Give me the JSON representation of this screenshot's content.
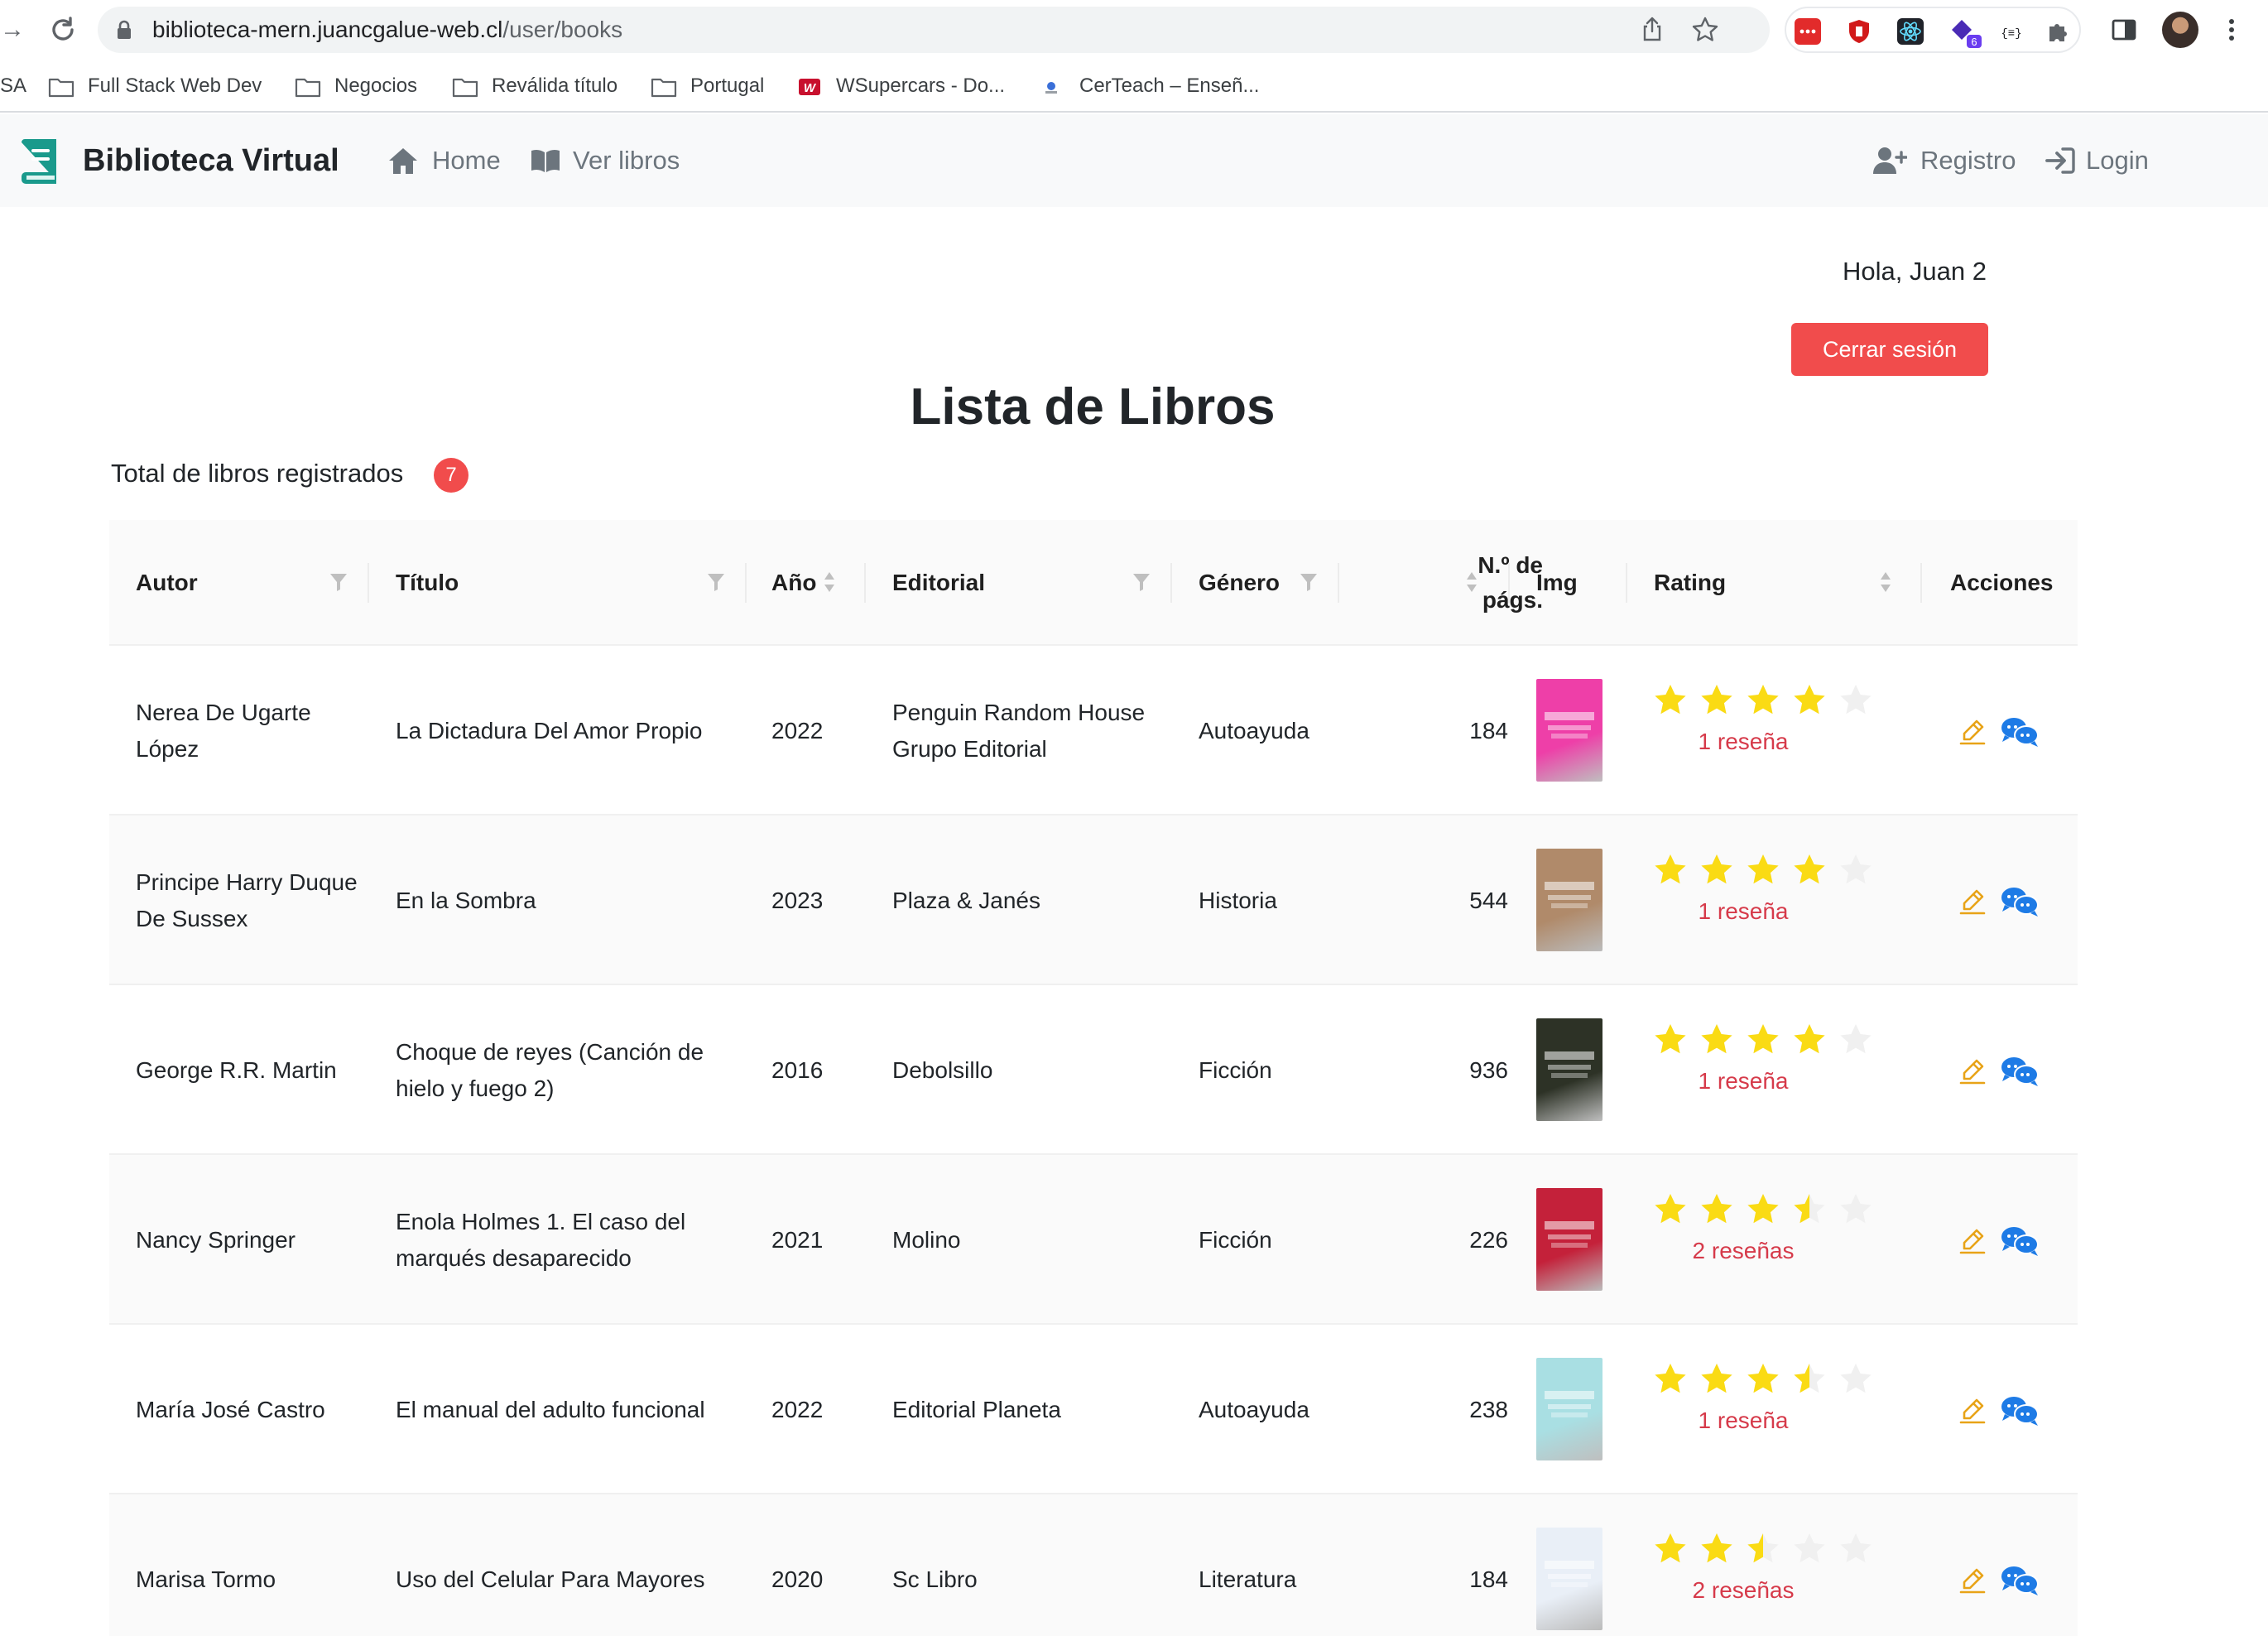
{
  "browser": {
    "url_host": "biblioteca-mern.juancgalue-web.cl",
    "url_path": "/user/books",
    "extension_badge": "6",
    "bookmarks": [
      {
        "label": "SA",
        "icon": "none"
      },
      {
        "label": "Full Stack Web Dev",
        "icon": "folder-icon"
      },
      {
        "label": "Negocios",
        "icon": "folder-icon"
      },
      {
        "label": "Reválida título",
        "icon": "folder-icon"
      },
      {
        "label": "Portugal",
        "icon": "folder-icon"
      },
      {
        "label": "WSupercars - Do...",
        "icon": "wsupercars-icon"
      },
      {
        "label": "CerTeach – Enseñ...",
        "icon": "certeach-icon"
      }
    ]
  },
  "navbar": {
    "brand": "Biblioteca Virtual",
    "home": "Home",
    "books": "Ver libros",
    "register": "Registro",
    "login": "Login"
  },
  "user": {
    "greeting": "Hola, Juan 2",
    "logout": "Cerrar sesión"
  },
  "page": {
    "title": "Lista de Libros",
    "total_label": "Total de libros registrados",
    "total_count": "7"
  },
  "table": {
    "headers": {
      "author": "Autor",
      "title": "Título",
      "year": "Año",
      "publisher": "Editorial",
      "genre": "Género",
      "pages_line1": "N.º de",
      "pages_line2": "págs.",
      "img": "Img",
      "rating": "Rating",
      "actions": "Acciones"
    },
    "rows": [
      {
        "author": "Nerea De Ugarte López",
        "title": "La Dictadura Del Amor Propio",
        "year": "2022",
        "publisher": "Penguin Random House Grupo Editorial",
        "genre": "Autoayuda",
        "pages": "184",
        "rating": 4,
        "reviews": "1 reseña",
        "cover_color": "#ee3fa8"
      },
      {
        "author": "Principe Harry Duque De Sussex",
        "title": "En la Sombra",
        "year": "2023",
        "publisher": "Plaza & Janés",
        "genre": "Historia",
        "pages": "544",
        "rating": 4,
        "reviews": "1 reseña",
        "cover_color": "#b08a6a"
      },
      {
        "author": "George R.R. Martin",
        "title": "Choque de reyes (Canción de hielo y fuego 2)",
        "year": "2016",
        "publisher": "Debolsillo",
        "genre": "Ficción",
        "pages": "936",
        "rating": 4,
        "reviews": "1 reseña",
        "cover_color": "#2d3226"
      },
      {
        "author": "Nancy Springer",
        "title": "Enola Holmes 1. El caso del marqués desaparecido",
        "year": "2021",
        "publisher": "Molino",
        "genre": "Ficción",
        "pages": "226",
        "rating": 3.5,
        "reviews": "2 reseñas",
        "cover_color": "#c4213a"
      },
      {
        "author": "María José Castro",
        "title": "El manual del adulto funcional",
        "year": "2022",
        "publisher": "Editorial Planeta",
        "genre": "Autoayuda",
        "pages": "238",
        "rating": 3.5,
        "reviews": "1 reseña",
        "cover_color": "#a9dfe3"
      },
      {
        "author": "Marisa Tormo",
        "title": "Uso del Celular Para Mayores",
        "year": "2020",
        "publisher": "Sc Libro",
        "genre": "Literatura",
        "pages": "184",
        "rating": 2.5,
        "reviews": "2 reseñas",
        "cover_color": "#e9eff7"
      }
    ]
  },
  "colors": {
    "accent_red": "#f14c4c",
    "star_gold": "#fadb14",
    "star_empty": "#f0f0f0",
    "edit_orange": "#e8a317",
    "chat_blue": "#1e7be6",
    "brand_teal": "#1a9a8c"
  }
}
